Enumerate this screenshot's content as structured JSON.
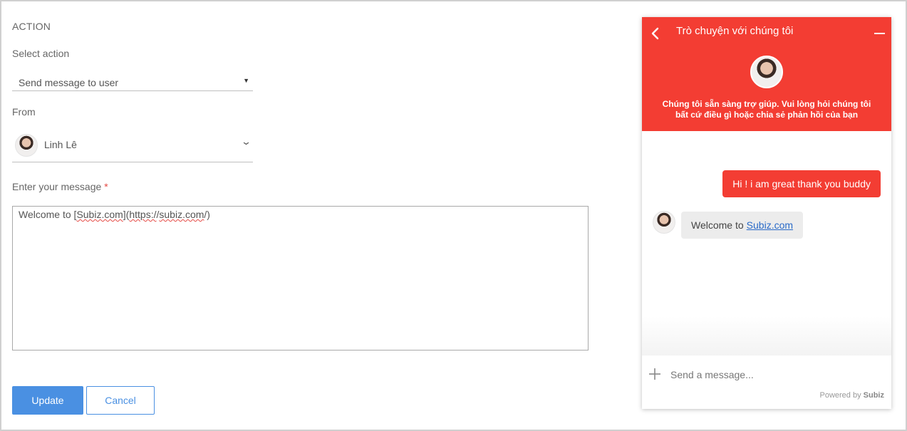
{
  "form": {
    "section_title": "ACTION",
    "select_action_label": "Select action",
    "select_action_value": "Send message to user",
    "from_label": "From",
    "from_value": "Linh Lê",
    "message_label": "Enter your message",
    "message_required_mark": "*",
    "message_parts": {
      "prefix": "Welcome to [",
      "link_text": "Subiz.com",
      "mid": "](",
      "url_scheme": "https:/",
      "url_sep": "/",
      "url_host": "subiz.com",
      "suffix": "/)"
    },
    "update_label": "Update",
    "cancel_label": "Cancel"
  },
  "widget": {
    "title": "Trò chuyện với chúng tôi",
    "subtitle": "Chúng tôi sẵn sàng trợ giúp. Vui lòng hỏi chúng tôi bất cứ điều gì hoặc chia sẻ phản hồi của bạn",
    "messages": {
      "outgoing": "Hi ! i am great thank you buddy",
      "incoming_prefix": "Welcome to",
      "incoming_link": "Subiz.com"
    },
    "input_placeholder": "Send a message...",
    "powered_prefix": "Powered by",
    "powered_brand": "Subiz"
  },
  "colors": {
    "brand_red": "#f33d33",
    "primary_blue": "#4a90e2",
    "required_red": "#e54a45"
  },
  "icons": {
    "select_caret": "▼",
    "from_chevron": "⌄"
  }
}
